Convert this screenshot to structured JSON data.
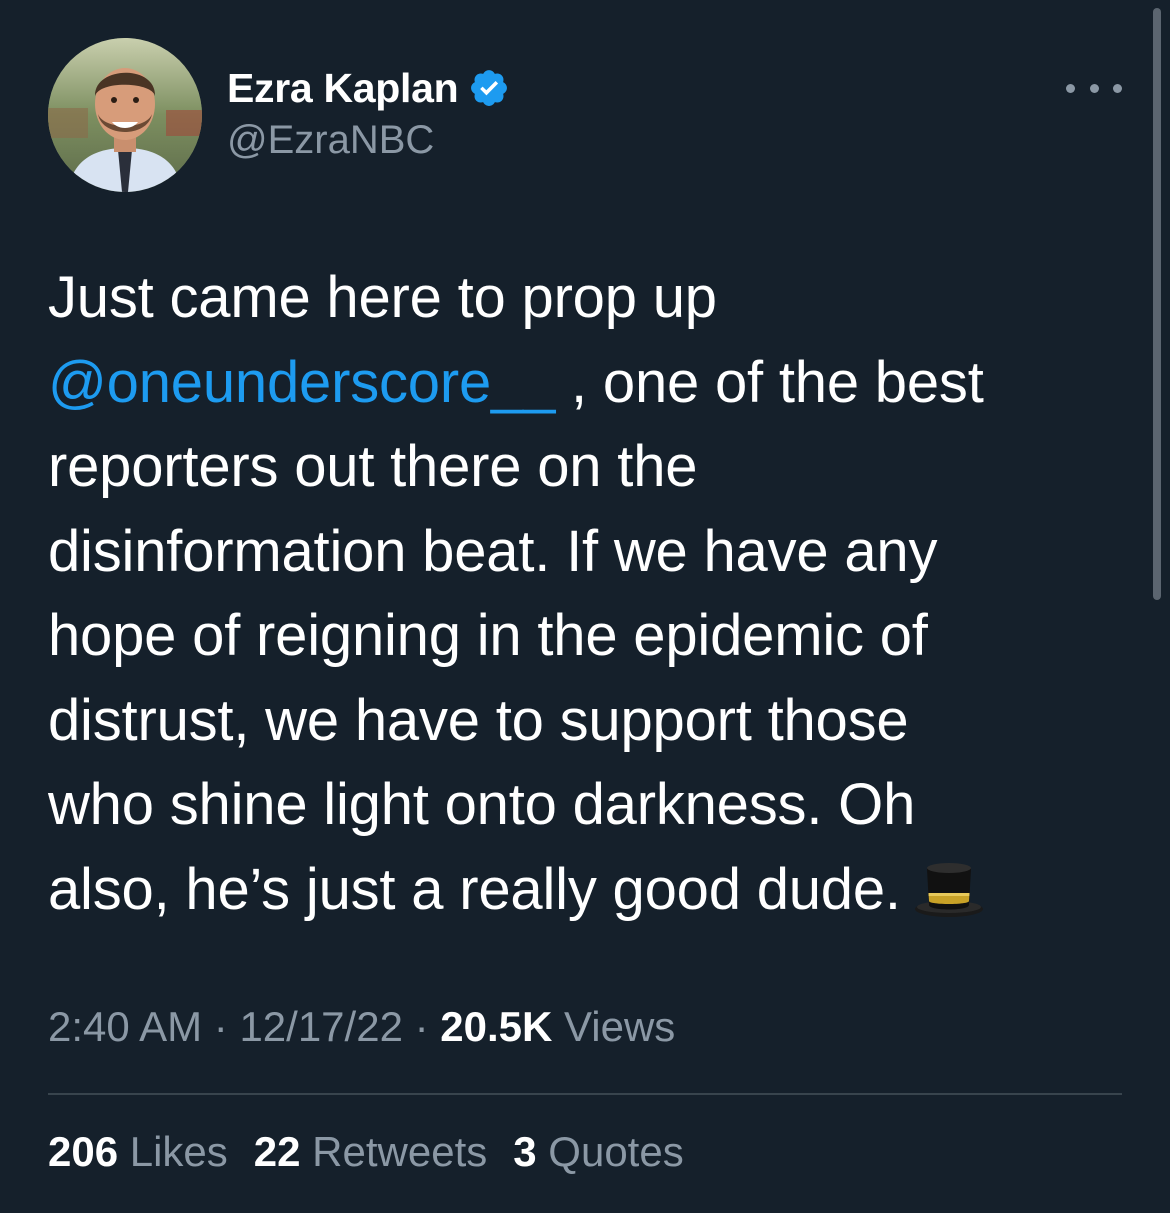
{
  "author": {
    "display_name": "Ezra Kaplan",
    "handle": "@EzraNBC",
    "verified_icon": "verified-badge-icon",
    "avatar": "profile-photo"
  },
  "tweet": {
    "lines": {
      "l1": "Just came here to prop up",
      "l2_mention": "@oneunderscore__",
      "l2_rest": " , one of the best",
      "l3": "reporters out there on the",
      "l4": "disinformation beat. If we have any",
      "l5": "hope of reigning in the epidemic of",
      "l6": "distrust, we have to support those",
      "l7": "who shine light onto darkness. Oh",
      "l8": "also, he’s just a really good dude."
    },
    "emoji": "top-hat-emoji"
  },
  "meta": {
    "time": "2:40 AM",
    "sep1": " · ",
    "date": "12/17/22",
    "sep2": " · ",
    "views_count": "20.5K",
    "views_label": " Views"
  },
  "stats": {
    "likes_count": "206",
    "likes_label": " Likes",
    "retweets_count": "22",
    "retweets_label": " Retweets",
    "quotes_count": "3",
    "quotes_label": " Quotes"
  },
  "colors": {
    "background": "#15202b",
    "text": "#ffffff",
    "secondary": "#8b98a5",
    "link": "#1d9bf0",
    "divider": "#38444d"
  }
}
